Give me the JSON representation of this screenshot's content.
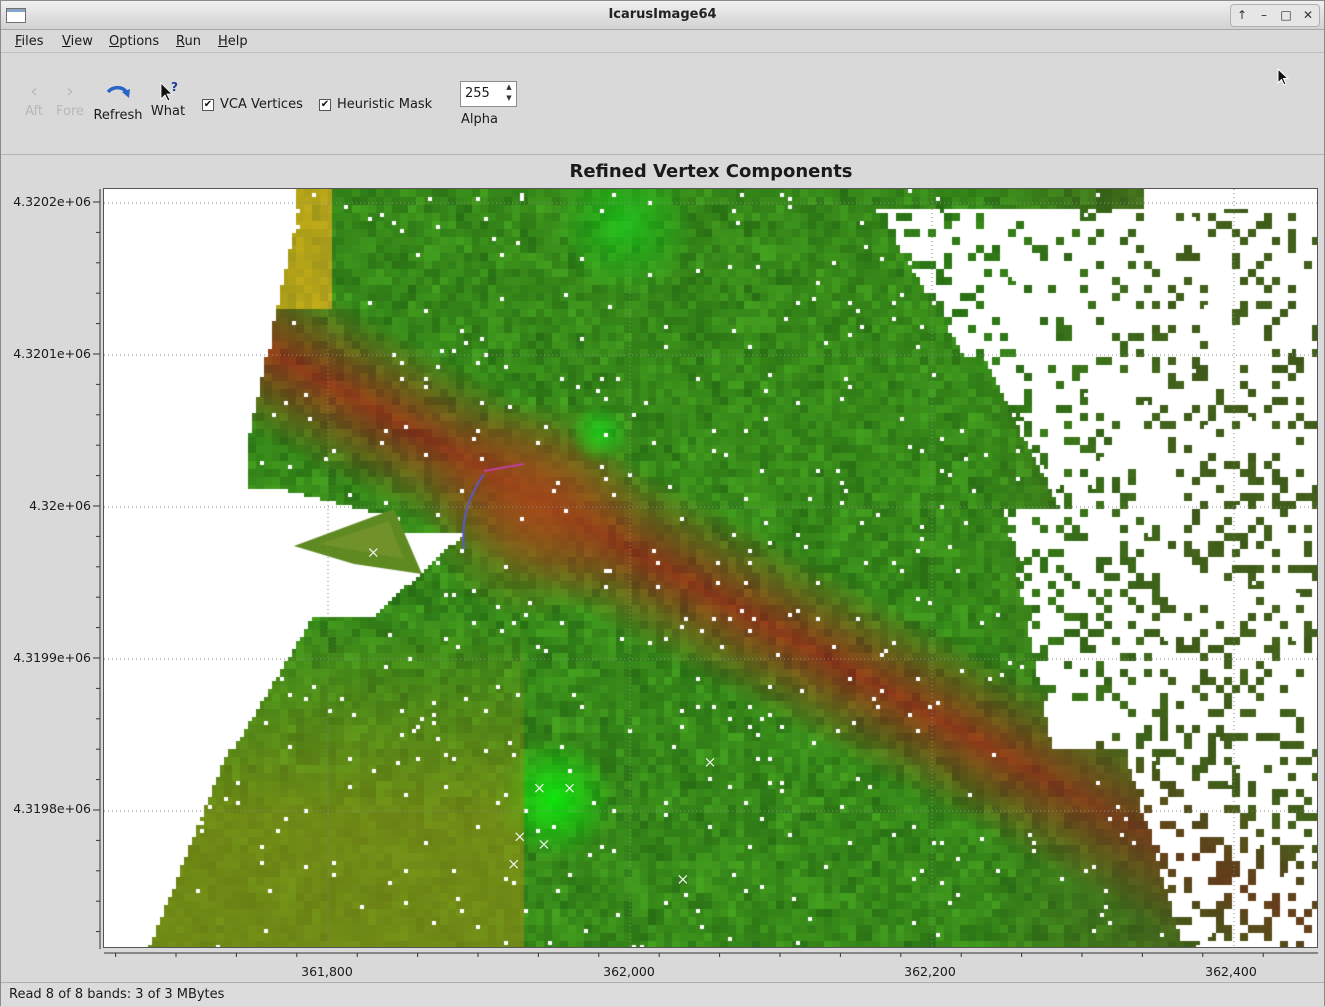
{
  "window": {
    "title": "IcarusImage64",
    "controls": [
      "↑",
      "–",
      "□",
      "✕"
    ]
  },
  "menu": [
    {
      "label": "Files",
      "accel": "F",
      "rest": "iles"
    },
    {
      "label": "View",
      "accel": "V",
      "rest": "iew"
    },
    {
      "label": "Options",
      "accel": "O",
      "rest": "ptions"
    },
    {
      "label": "Run",
      "accel": "R",
      "rest": "un"
    },
    {
      "label": "Help",
      "accel": "H",
      "rest": "elp"
    }
  ],
  "toolbar": {
    "aft": {
      "label": "Aft",
      "icon": "arrow-left-icon",
      "enabled": false
    },
    "fore": {
      "label": "Fore",
      "icon": "arrow-right-icon",
      "enabled": false
    },
    "refresh": {
      "label": "Refresh",
      "icon": "refresh-icon"
    },
    "what": {
      "label": "What",
      "icon": "whats-this-icon"
    },
    "vca_vertices": {
      "label": "VCA Vertices",
      "checked": true
    },
    "heuristic_mask": {
      "label": "Heuristic Mask",
      "checked": true
    },
    "alpha": {
      "label": "Alpha",
      "value": "255"
    }
  },
  "plot": {
    "title": "Refined Vertex Components",
    "y_ticks": [
      "4.3202e+06",
      "4.3201e+06",
      "4.32e+06",
      "4.3199e+06",
      "4.3198e+06"
    ],
    "x_ticks": [
      "361,800",
      "362,000",
      "362,200",
      "362,400"
    ],
    "vertex_markers": [
      {
        "x": 361830,
        "y": 4319970
      },
      {
        "x": 362053,
        "y": 4319832
      },
      {
        "x": 361940,
        "y": 4319815
      },
      {
        "x": 361960,
        "y": 4319815
      },
      {
        "x": 361927,
        "y": 4319783
      },
      {
        "x": 361943,
        "y": 4319778
      },
      {
        "x": 361923,
        "y": 4319765
      },
      {
        "x": 362035,
        "y": 4319755
      }
    ],
    "colors": {
      "green": "#3c8a1e",
      "bright_green": "#22e11c",
      "red_brown": "#7a2a1a",
      "olive": "#6f6a1c",
      "dark": "#3d3a1a"
    }
  },
  "status": {
    "text": "Read 8 of 8 bands: 3 of 3 MBytes"
  }
}
